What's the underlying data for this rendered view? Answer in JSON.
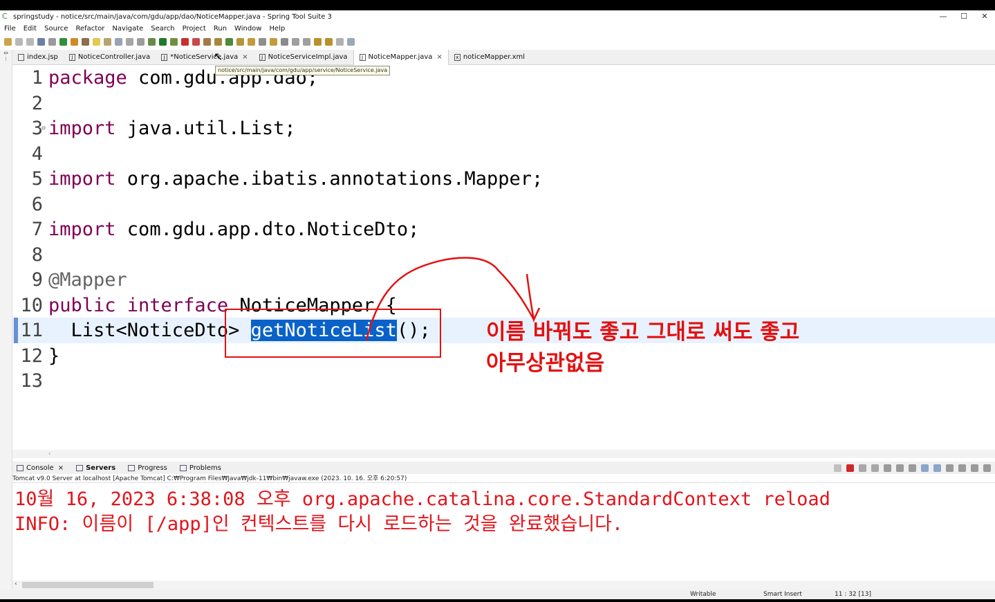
{
  "window": {
    "title": "springstudy - notice/src/main/java/com/gdu/app/dao/NoticeMapper.java - Spring Tool Suite 3",
    "controls": [
      "—",
      "☐",
      "✕"
    ]
  },
  "menu": [
    "File",
    "Edit",
    "Source",
    "Refactor",
    "Navigate",
    "Search",
    "Project",
    "Run",
    "Window",
    "Help"
  ],
  "tabs": [
    {
      "label": "index.jsp",
      "icon": "jsp-file-icon",
      "active": false,
      "closable": false
    },
    {
      "label": "NoticeController.java",
      "icon": "java-file-icon",
      "active": false,
      "closable": false
    },
    {
      "label": "*NoticeService.java",
      "icon": "java-file-icon",
      "active": false,
      "closable": true
    },
    {
      "label": "NoticeServiceImpl.java",
      "icon": "java-file-icon",
      "active": false,
      "closable": false
    },
    {
      "label": "NoticeMapper.java",
      "icon": "java-file-icon",
      "active": true,
      "closable": true
    },
    {
      "label": "noticeMapper.xml",
      "icon": "xml-file-icon",
      "active": false,
      "closable": false
    }
  ],
  "tab_close_glyph": "×",
  "tooltip": "notice/src/main/java/com/gdu/app/service/NoticeService.java",
  "editor": {
    "lines": [
      {
        "n": "1",
        "kw": "package",
        "rest": " com.gdu.app.dao;"
      },
      {
        "n": "2",
        "kw": "",
        "rest": ""
      },
      {
        "n": "3",
        "kw": "import",
        "rest": " java.util.List;"
      },
      {
        "n": "4",
        "kw": "",
        "rest": ""
      },
      {
        "n": "5",
        "kw": "import",
        "rest": " org.apache.ibatis.annotations.Mapper;"
      },
      {
        "n": "6",
        "kw": "",
        "rest": ""
      },
      {
        "n": "7",
        "kw": "import",
        "rest": " com.gdu.app.dto.NoticeDto;"
      },
      {
        "n": "8",
        "kw": "",
        "rest": ""
      },
      {
        "n": "9",
        "kw": "",
        "rest": "@Mapper"
      },
      {
        "n": "10",
        "kw": "public interface",
        "rest": " NoticeMapper {"
      },
      {
        "n": "11",
        "kw": "",
        "rest": "  List<NoticeDto> ",
        "selected": "getNoticeList",
        "after": "();"
      },
      {
        "n": "12",
        "kw": "",
        "rest": "}"
      },
      {
        "n": "13",
        "kw": "",
        "rest": ""
      }
    ],
    "current_line": "11"
  },
  "annotation": {
    "line1": "이름 바꿔도 좋고 그대로 써도 좋고",
    "line2": "아무상관없음",
    "color": "#e31010"
  },
  "console": {
    "tabs": [
      {
        "label": "Console",
        "closable": true,
        "bold": false
      },
      {
        "label": "Servers",
        "closable": false,
        "bold": true
      },
      {
        "label": "Progress",
        "closable": false,
        "bold": false
      },
      {
        "label": "Problems",
        "closable": false,
        "bold": false
      }
    ],
    "description": "Tomcat v9.0 Server at localhost [Apache Tomcat] C:₩Program Files₩Java₩jdk-11₩bin₩javaw.exe  (2023. 10. 16. 오후 6:20:57)",
    "lines": [
      "10월 16, 2023 6:38:08 오후 org.apache.catalina.core.StandardContext reload",
      "INFO: 이름이 [/app]인 컨텍스트를 다시 로드하는 것을 완료했습니다."
    ],
    "text_color": "#e3141b"
  },
  "status": {
    "writable": "Writable",
    "insert_mode": "Smart Insert",
    "position": "11 : 32 [13]"
  }
}
